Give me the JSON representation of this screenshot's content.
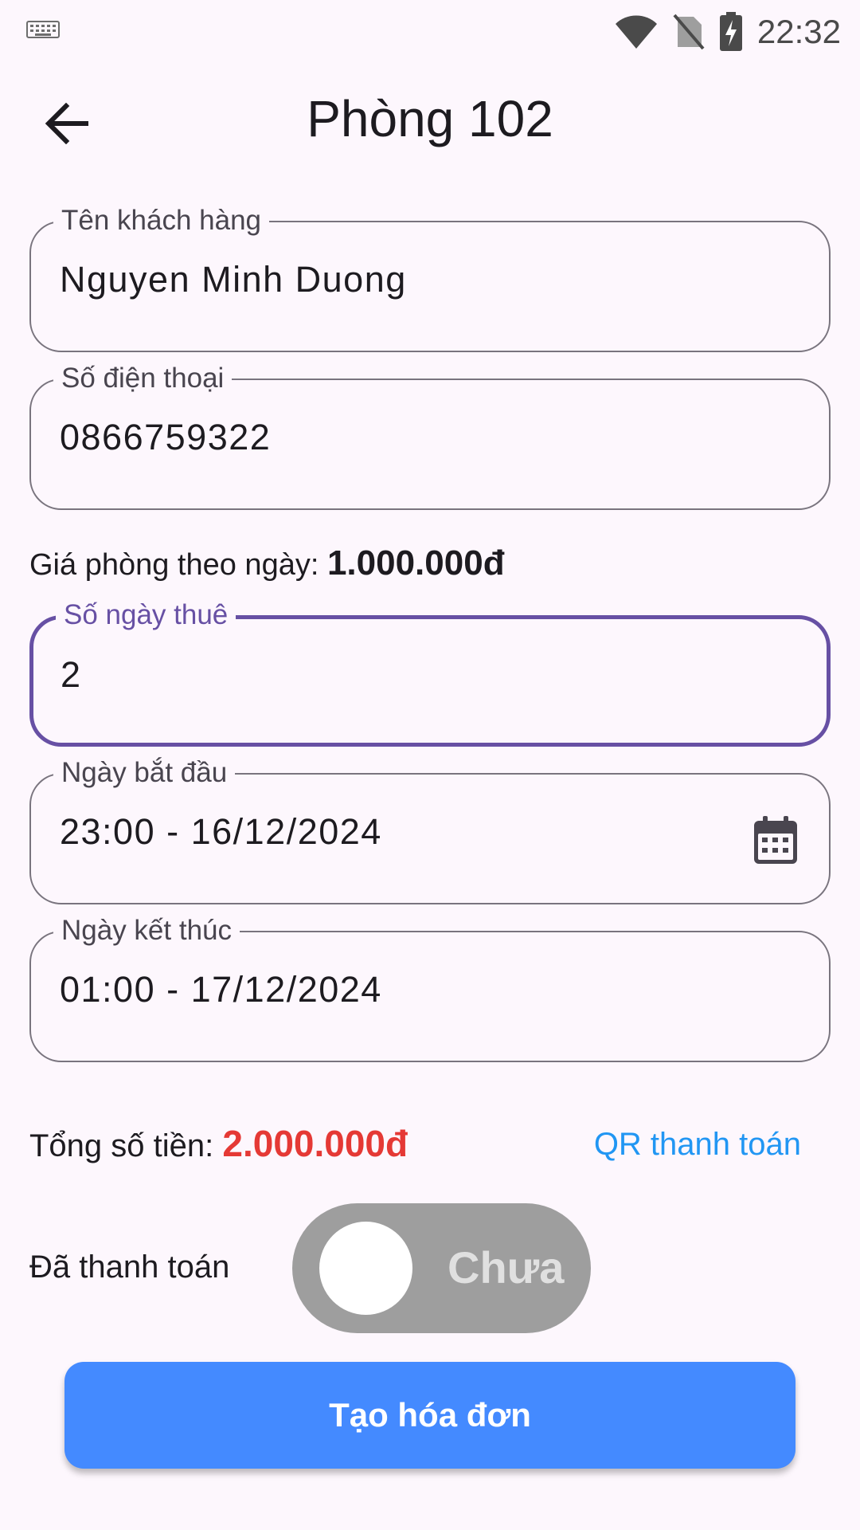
{
  "status_bar": {
    "time": "22:32",
    "left_icon": "keyboard-icon",
    "icons": [
      "wifi-icon",
      "no-sim-icon",
      "battery-charging-icon"
    ]
  },
  "app_bar": {
    "title": "Phòng 102",
    "back_icon": "arrow-back-icon"
  },
  "form": {
    "customer_name": {
      "label": "Tên khách hàng",
      "value": "Nguyen Minh Duong"
    },
    "phone": {
      "label": "Số điện thoại",
      "value": "0866759322"
    },
    "price": {
      "label": "Giá phòng theo ngày: ",
      "value": "1.000.000đ"
    },
    "days": {
      "label": "Số ngày thuê",
      "value": "2"
    },
    "start_date": {
      "label": "Ngày bắt đầu",
      "value": "23:00 - 16/12/2024",
      "icon": "calendar-icon"
    },
    "end_date": {
      "label": "Ngày kết thúc",
      "value": "01:00 - 17/12/2024"
    }
  },
  "total": {
    "label": "Tổng số tiền: ",
    "value": "2.000.000đ",
    "qr_link": "QR thanh toán"
  },
  "payment": {
    "label": "Đã thanh toán",
    "toggle_text": "Chưa",
    "paid": false
  },
  "actions": {
    "create_invoice": "Tạo hóa đơn"
  },
  "colors": {
    "background": "#fdf7fd",
    "focus": "#6750a4",
    "total": "#e53935",
    "link": "#2196f3",
    "button": "#448aff",
    "toggle_off": "#9e9e9e"
  }
}
